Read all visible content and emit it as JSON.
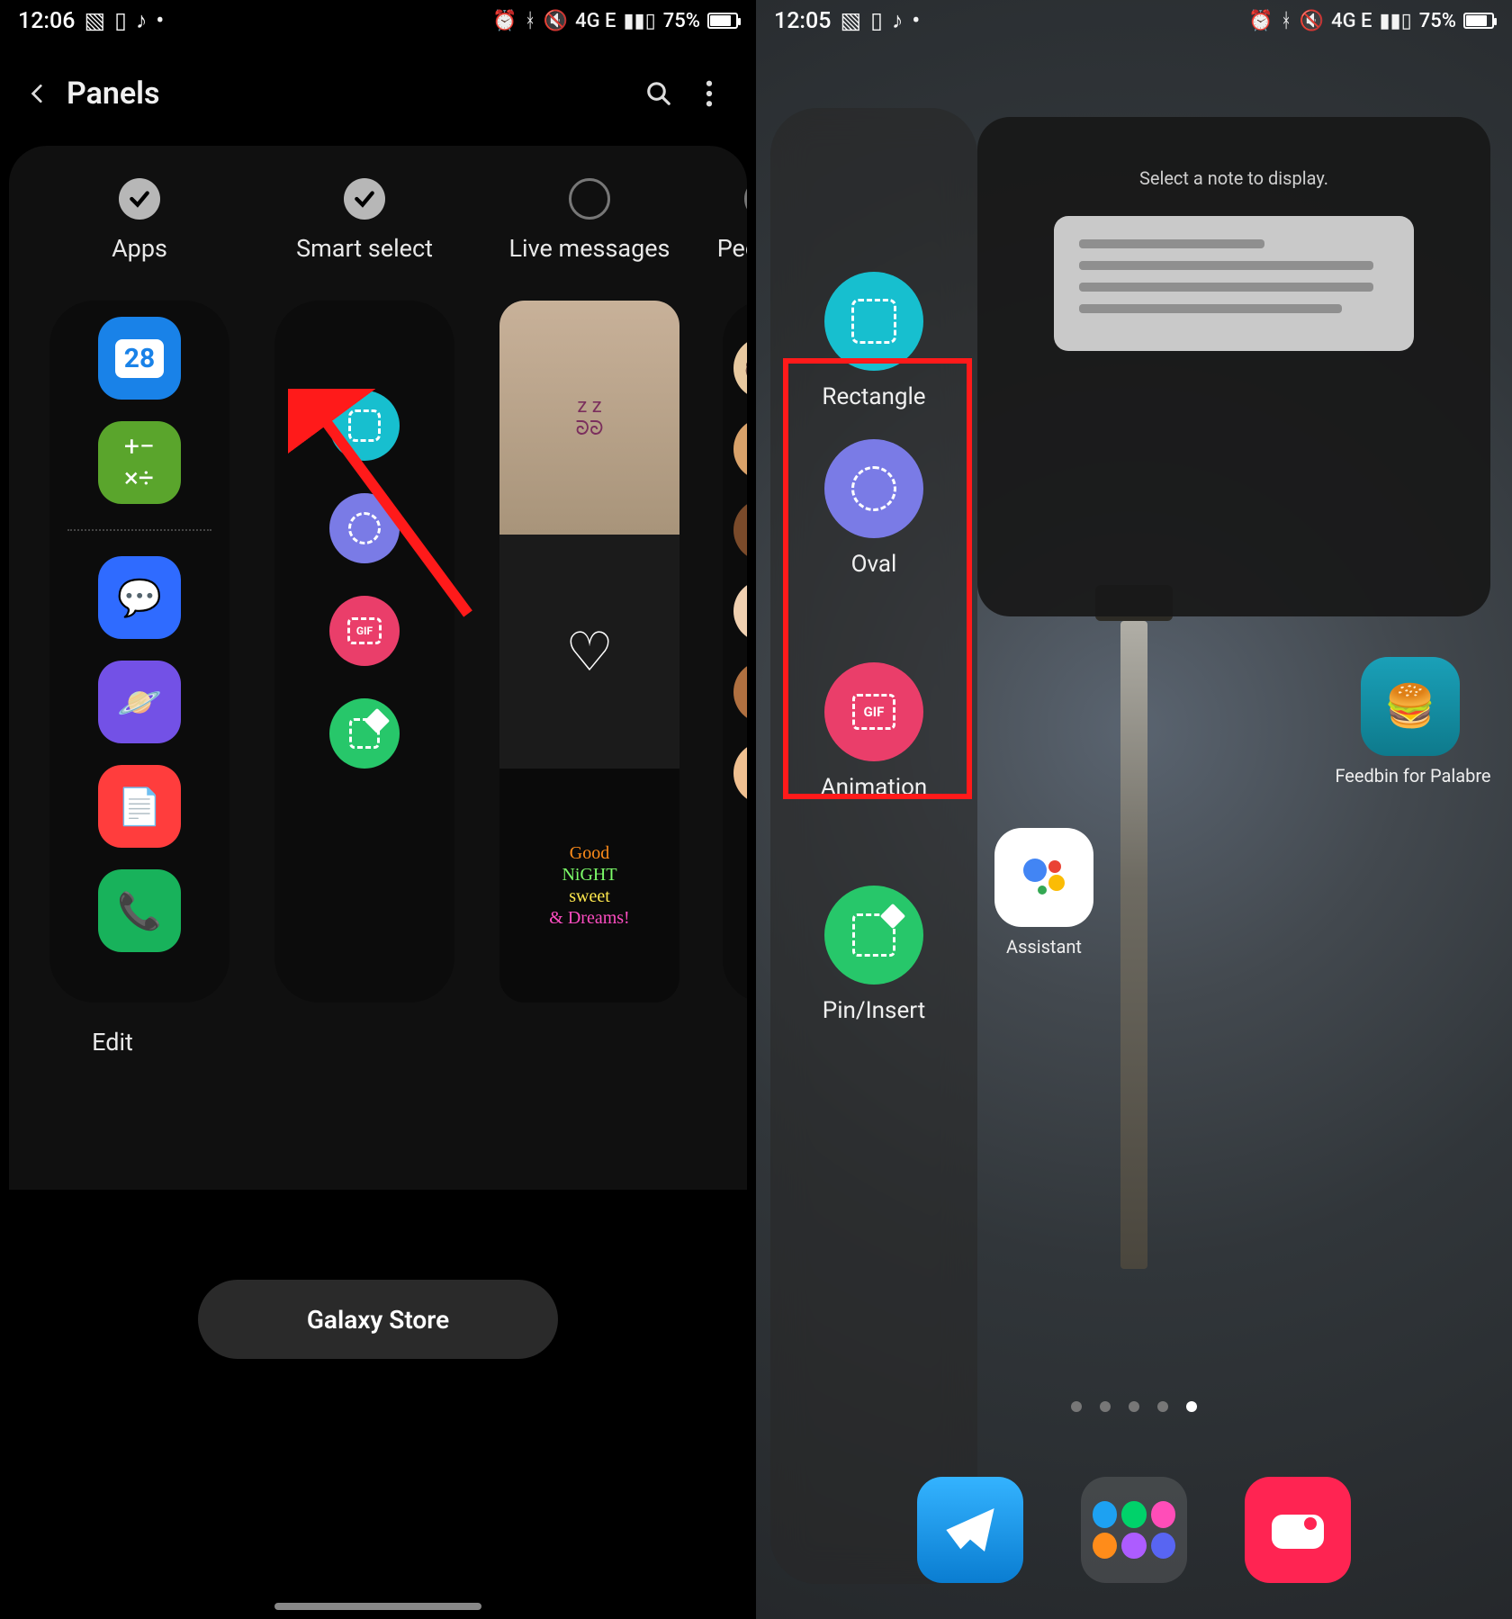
{
  "statusbar": {
    "left": {
      "time_left": "12:06",
      "time_right": "12:05",
      "icons": [
        "image-icon",
        "sim-icon",
        "music-icon",
        "dot-icon"
      ]
    },
    "right": {
      "net_label": "4G E",
      "battery_pct": "75%",
      "battery_fill_pct": 75
    }
  },
  "left_phone": {
    "title": "Panels",
    "panels": [
      {
        "id": "apps",
        "label": "Apps",
        "checked": true
      },
      {
        "id": "smart-select",
        "label": "Smart select",
        "checked": true
      },
      {
        "id": "live-messages",
        "label": "Live messages",
        "checked": false
      },
      {
        "id": "people",
        "label": "People",
        "checked": false
      }
    ],
    "apps_preview": {
      "top": {
        "calendar_day": "28"
      },
      "bottom_icons": [
        "messages",
        "browser",
        "notes",
        "phone"
      ]
    },
    "smart_select_preview": [
      "rectangle",
      "oval",
      "gif",
      "pin"
    ],
    "live_messages_preview": {
      "lines": [
        "Good",
        "NiGHT",
        "sweet",
        "& Dreams!"
      ]
    },
    "edit_label": "Edit",
    "store_button": "Galaxy Store"
  },
  "right_phone": {
    "note_widget": {
      "msg": "Select a note to display."
    },
    "edge_items": [
      {
        "id": "rectangle",
        "label": "Rectangle",
        "color": "#17bfcf"
      },
      {
        "id": "oval",
        "label": "Oval",
        "color": "#7a7be6"
      },
      {
        "id": "animation",
        "label": "Animation",
        "color": "#ea3e6a"
      },
      {
        "id": "pin-insert",
        "label": "Pin/Insert",
        "color": "#27c76a"
      }
    ],
    "home_apps": {
      "feedbin": {
        "label": "Feedbin for Palabre"
      },
      "assistant": {
        "label": "Assistant"
      }
    },
    "pager": {
      "count": 5,
      "active_index": 4
    },
    "dock": [
      "telegram",
      "folder",
      "camera"
    ]
  }
}
